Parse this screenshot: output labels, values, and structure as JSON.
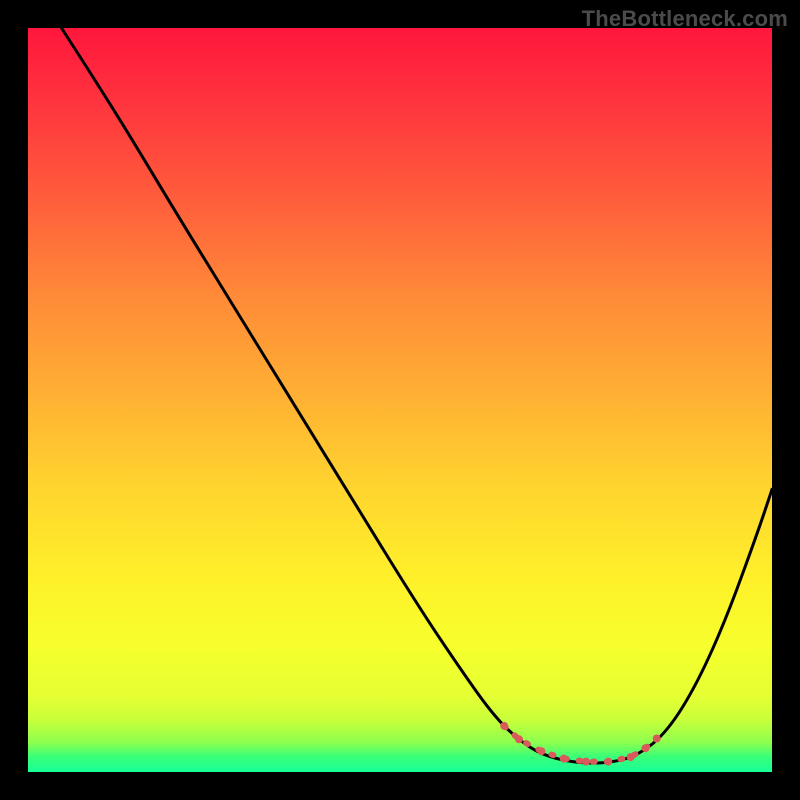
{
  "watermark": "TheBottleneck.com",
  "chart_data": {
    "type": "line",
    "title": "",
    "xlabel": "",
    "ylabel": "",
    "xlim": [
      0,
      1
    ],
    "ylim": [
      0,
      1
    ],
    "gradient_stops": [
      {
        "pos": 0.0,
        "color": "#ff173c"
      },
      {
        "pos": 0.08,
        "color": "#ff2e3e"
      },
      {
        "pos": 0.22,
        "color": "#ff5a3c"
      },
      {
        "pos": 0.36,
        "color": "#ff8a38"
      },
      {
        "pos": 0.5,
        "color": "#ffb233"
      },
      {
        "pos": 0.62,
        "color": "#ffd52e"
      },
      {
        "pos": 0.74,
        "color": "#fff02a"
      },
      {
        "pos": 0.83,
        "color": "#f6ff2c"
      },
      {
        "pos": 0.9,
        "color": "#e4ff33"
      },
      {
        "pos": 0.93,
        "color": "#c8ff3a"
      },
      {
        "pos": 0.96,
        "color": "#8dff4e"
      },
      {
        "pos": 0.98,
        "color": "#38ff7a"
      },
      {
        "pos": 1.0,
        "color": "#18ff98"
      }
    ],
    "series": [
      {
        "name": "bottleneck-curve",
        "color": "#000000",
        "points": [
          {
            "x": 0.045,
            "y": 1.0
          },
          {
            "x": 0.09,
            "y": 0.93
          },
          {
            "x": 0.14,
            "y": 0.85
          },
          {
            "x": 0.2,
            "y": 0.75
          },
          {
            "x": 0.28,
            "y": 0.62
          },
          {
            "x": 0.36,
            "y": 0.49
          },
          {
            "x": 0.44,
            "y": 0.36
          },
          {
            "x": 0.52,
            "y": 0.23
          },
          {
            "x": 0.58,
            "y": 0.14
          },
          {
            "x": 0.63,
            "y": 0.07
          },
          {
            "x": 0.67,
            "y": 0.035
          },
          {
            "x": 0.7,
            "y": 0.02
          },
          {
            "x": 0.74,
            "y": 0.012
          },
          {
            "x": 0.78,
            "y": 0.012
          },
          {
            "x": 0.82,
            "y": 0.022
          },
          {
            "x": 0.86,
            "y": 0.055
          },
          {
            "x": 0.9,
            "y": 0.12
          },
          {
            "x": 0.94,
            "y": 0.21
          },
          {
            "x": 0.98,
            "y": 0.32
          },
          {
            "x": 1.0,
            "y": 0.38
          }
        ]
      },
      {
        "name": "optimal-marker",
        "color": "#d85a5a",
        "points": [
          {
            "x": 0.64,
            "y": 0.062
          },
          {
            "x": 0.66,
            "y": 0.044
          },
          {
            "x": 0.69,
            "y": 0.028
          },
          {
            "x": 0.72,
            "y": 0.018
          },
          {
            "x": 0.75,
            "y": 0.014
          },
          {
            "x": 0.78,
            "y": 0.014
          },
          {
            "x": 0.81,
            "y": 0.02
          },
          {
            "x": 0.83,
            "y": 0.032
          },
          {
            "x": 0.845,
            "y": 0.045
          }
        ]
      }
    ]
  }
}
